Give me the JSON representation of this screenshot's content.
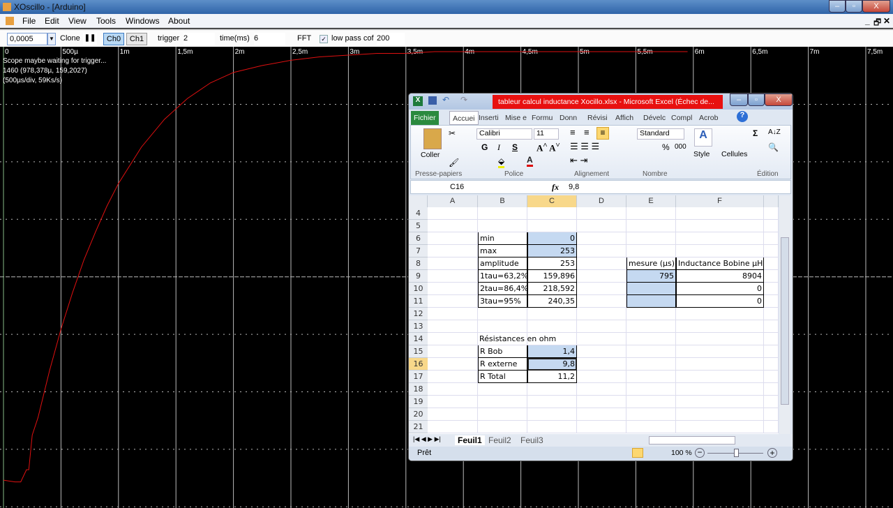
{
  "window": {
    "title": "XOscillo - [Arduino]",
    "min": "–",
    "max": "▫",
    "close": "X"
  },
  "menu": [
    "File",
    "Edit",
    "View",
    "Tools",
    "Windows",
    "About"
  ],
  "toolbar": {
    "timebase": "0,0005",
    "clone": "Clone",
    "pause": "❚❚",
    "ch0": "Ch0",
    "ch1": "Ch1",
    "trigger_label": "trigger",
    "trigger_value": "2",
    "time_label": "time(ms)",
    "time_value": "6",
    "fft": "FFT",
    "lowpass_checked": true,
    "lowpass_label": "low pass cof",
    "lowpass_value": "200"
  },
  "scope": {
    "status": "Scope maybe waiting for trigger...",
    "cursor": "1460 (978,378µ, 159,2027)",
    "scale": "(500µs/div, 59Ks/s)",
    "trace_color": "#e01010"
  },
  "chart_data": {
    "type": "line",
    "x_unit": "s",
    "x_ticks": [
      "0",
      "500µ",
      "1m",
      "1,5m",
      "2m",
      "2,5m",
      "3m",
      "3,5m",
      "4m",
      "4,5m",
      "5m",
      "5,5m",
      "6m",
      "6,5m",
      "7m",
      "7,5m"
    ],
    "xlim_ms": [
      0,
      7.7
    ],
    "ylim": [
      -40,
      260
    ],
    "grid": true,
    "series": [
      {
        "x_ms": [
          0,
          0.1,
          0.15,
          0.2,
          0.22,
          0.25,
          0.3,
          0.4,
          0.5,
          0.6,
          0.7,
          0.8,
          0.9,
          1.0,
          1.2,
          1.4,
          1.6,
          1.8,
          2.0,
          2.25,
          2.5,
          2.75,
          3.0,
          3.25,
          3.5,
          3.75,
          4.0,
          4.5,
          5.0,
          5.5,
          5.95
        ],
        "y": [
          6,
          5,
          5,
          12,
          12,
          32,
          42,
          69,
          93,
          114,
          133,
          149,
          164,
          177,
          198,
          214,
          226,
          235,
          241,
          245,
          248,
          250,
          251,
          252,
          252,
          253,
          253,
          253,
          253,
          253,
          253
        ]
      }
    ]
  },
  "excel": {
    "title": "tableur calcul inductance Xocillo.xlsx - Microsoft Excel (Échec de...",
    "tabs": [
      "Fichier",
      "Accuei",
      "Inserti",
      "Mise e",
      "Formu",
      "Donn",
      "Révisi",
      "Affich",
      "Dévelc",
      "Compl",
      "Acrob"
    ],
    "ribbon": {
      "paste": "Coller",
      "font": "Calibri",
      "size": "11",
      "bold": "G",
      "italic": "I",
      "underline": "S",
      "format": "Standard",
      "percent": "%",
      "thousands": "000",
      "style": "Style",
      "cells": "Cellules",
      "groups": [
        "Presse-papiers",
        "Police",
        "Alignement",
        "Nombre",
        "Édition"
      ]
    },
    "namebox": "C16",
    "fx": "fx",
    "formula": "9,8",
    "columns": [
      "A",
      "B",
      "C",
      "D",
      "E",
      "F"
    ],
    "rows": [
      {
        "n": "4"
      },
      {
        "n": "5"
      },
      {
        "n": "6",
        "B": "min",
        "C": "0"
      },
      {
        "n": "7",
        "B": "max",
        "C": "253"
      },
      {
        "n": "8",
        "B": "amplitude",
        "C": "253",
        "E": "mesure (µs)",
        "F": "Inductance Bobine µH"
      },
      {
        "n": "9",
        "B": "1tau=63,2%",
        "C": "159,896",
        "E": "795",
        "F": "8904"
      },
      {
        "n": "10",
        "B": "2tau=86,4%",
        "C": "218,592",
        "F": "0"
      },
      {
        "n": "11",
        "B": "3tau=95%",
        "C": "240,35",
        "F": "0"
      },
      {
        "n": "12"
      },
      {
        "n": "13"
      },
      {
        "n": "14",
        "B": "Résistances en ohm"
      },
      {
        "n": "15",
        "B": "R Bob",
        "C": "1,4"
      },
      {
        "n": "16",
        "B": "R externe",
        "C": "9,8"
      },
      {
        "n": "17",
        "B": "R Total",
        "C": "11,2"
      },
      {
        "n": "18"
      },
      {
        "n": "19"
      },
      {
        "n": "20"
      },
      {
        "n": "21"
      }
    ],
    "sheets": [
      "Feuil1",
      "Feuil2",
      "Feuil3"
    ],
    "status": "Prêt",
    "zoom": "100 %",
    "selection_color": "#c5d9f1"
  }
}
